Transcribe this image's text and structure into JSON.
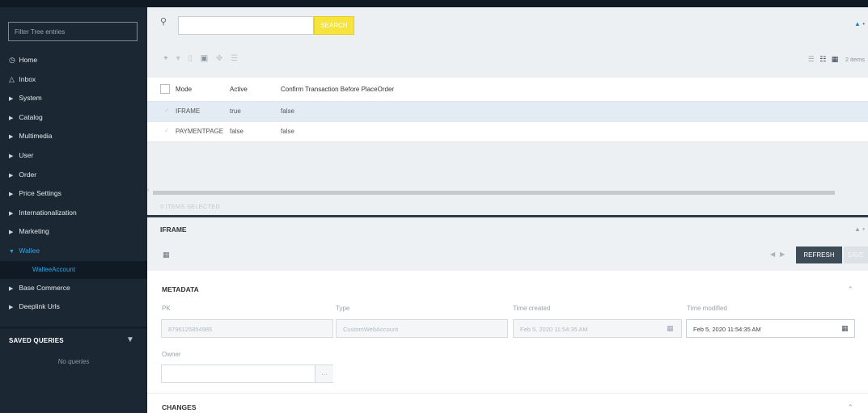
{
  "sidebar": {
    "filter_placeholder": "Filter Tree entries",
    "items": [
      {
        "label": "Home",
        "icon": "home-icon"
      },
      {
        "label": "Inbox",
        "icon": "inbox-icon"
      },
      {
        "label": "System",
        "icon": "caret-right-icon"
      },
      {
        "label": "Catalog",
        "icon": "caret-right-icon"
      },
      {
        "label": "Multimedia",
        "icon": "caret-right-icon"
      },
      {
        "label": "User",
        "icon": "caret-right-icon"
      },
      {
        "label": "Order",
        "icon": "caret-right-icon"
      },
      {
        "label": "Price Settings",
        "icon": "caret-right-icon"
      },
      {
        "label": "Internationalization",
        "icon": "caret-right-icon"
      },
      {
        "label": "Marketing",
        "icon": "caret-right-icon"
      },
      {
        "label": "Wallee",
        "icon": "caret-down-icon",
        "expanded": true
      },
      {
        "label": "WalleeAccount",
        "sub": true
      },
      {
        "label": "Base Commerce",
        "icon": "caret-right-icon"
      },
      {
        "label": "Deeplink Urls",
        "icon": "caret-right-icon"
      }
    ],
    "saved_queries": {
      "title": "SAVED QUERIES",
      "empty": "No queries"
    }
  },
  "search": {
    "placeholder": "",
    "button": "SEARCH"
  },
  "list": {
    "items_count": "2 items",
    "columns": [
      "Mode",
      "Active",
      "Confirm Transaction Before PlaceOrder"
    ],
    "rows": [
      {
        "mode": "IFRAME",
        "active": "true",
        "confirm": "false",
        "selected": true
      },
      {
        "mode": "PAYMENTPAGE",
        "active": "false",
        "confirm": "false",
        "selected": false
      }
    ],
    "items_selected": "0 ITEMS SELECTED"
  },
  "editor": {
    "title": "IFRAME",
    "refresh": "REFRESH",
    "save": "SAVE",
    "metadata": {
      "title": "METADATA",
      "pk_label": "PK",
      "pk_value": "8796125854985",
      "type_label": "Type",
      "type_value": "CustomWebAccount",
      "created_label": "Time created",
      "created_value": "Feb 5, 2020 11:54:35 AM",
      "modified_label": "Time modified",
      "modified_value": "Feb 5, 2020 11:54:35 AM",
      "owner_label": "Owner",
      "owner_value": "",
      "owner_dots": "…"
    },
    "changes": {
      "title": "CHANGES"
    }
  },
  "colors": {
    "sidebar_bg": "#1b2834",
    "accent": "#3aa0dc",
    "search_button": "#f6e33d",
    "refresh_button": "#3e4c58"
  }
}
